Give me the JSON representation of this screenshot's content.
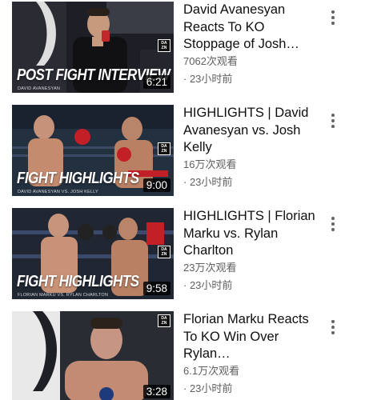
{
  "videos": [
    {
      "title": "David Avanesyan Reacts To KO Stoppage of Josh…",
      "views": "7062次观看",
      "age": "· 23小时前",
      "duration": "6:21",
      "overlay_title": "POST FIGHT INTERVIEW",
      "overlay_sub": "DAVID AVANESYAN",
      "icon": "dazn-logo-icon"
    },
    {
      "title": "HIGHLIGHTS | David Avanesyan vs. Josh Kelly",
      "views": "16万次观看",
      "age": "· 23小时前",
      "duration": "9:00",
      "overlay_title": "FIGHT HIGHLIGHTS",
      "overlay_sub": "DAVID AVANESYAN VS. JOSH KELLY",
      "icon": "dazn-logo-icon"
    },
    {
      "title": "HIGHLIGHTS | Florian Marku vs. Rylan Charlton",
      "views": "23万次观看",
      "age": "· 23小时前",
      "duration": "9:58",
      "overlay_title": "FIGHT HIGHLIGHTS",
      "overlay_sub": "FLORIAN MARKU VS. RYLAN CHARLTON",
      "icon": "dazn-logo-icon"
    },
    {
      "title": "Florian Marku Reacts To KO Win Over Rylan…",
      "views": "6.1万次观看",
      "age": "· 23小时前",
      "duration": "3:28",
      "overlay_title": "",
      "overlay_sub": "",
      "icon": "dazn-logo-icon"
    }
  ],
  "dazn_badge": "DA ZN",
  "colors": {
    "title_text": "#0f0f0f",
    "meta_text": "#606060",
    "duration_bg": "#000000"
  }
}
